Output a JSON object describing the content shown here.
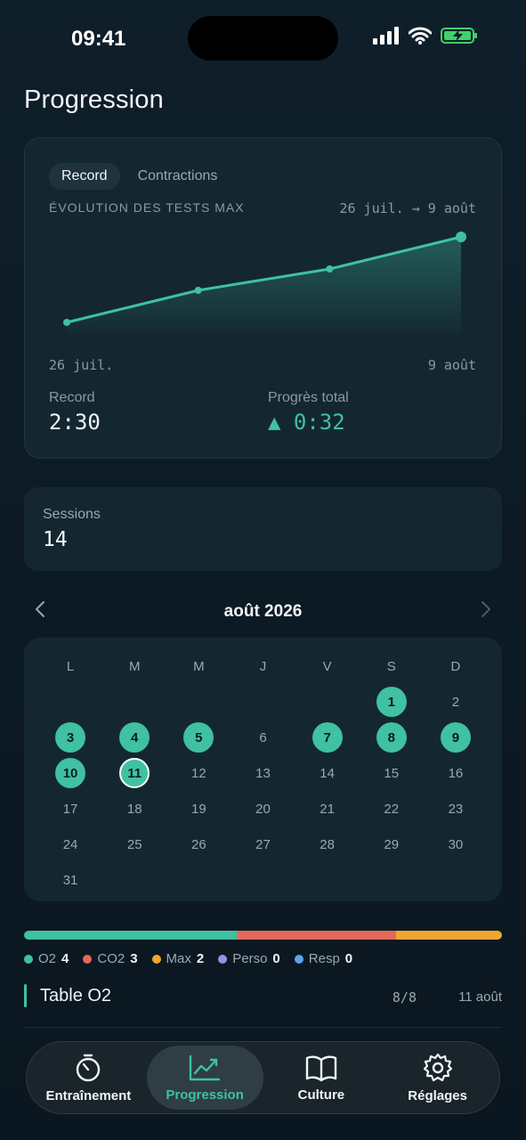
{
  "status_bar": {
    "time": "09:41"
  },
  "page": {
    "title": "Progression"
  },
  "chart_card": {
    "tabs": [
      {
        "label": "Record",
        "active": true
      },
      {
        "label": "Contractions",
        "active": false
      }
    ],
    "section_label": "ÉVOLUTION DES TESTS MAX",
    "date_range": "26 juil. → 9 août",
    "axis_start": "26 juil.",
    "axis_end": "9 août",
    "record_label": "Record",
    "record_value": "2:30",
    "progress_label": "Progrès total",
    "progress_value": "▲ 0:32"
  },
  "chart_data": {
    "type": "area",
    "x": [
      "26 juil.",
      "",
      "",
      "9 août"
    ],
    "series": [
      {
        "values": [
          118,
          130,
          138,
          150
        ]
      }
    ],
    "ylim": [
      112,
      152
    ],
    "grid": false,
    "color": "#3fc1a2"
  },
  "sessions": {
    "label": "Sessions",
    "value": "14"
  },
  "calendar": {
    "month": "août 2026",
    "prev_icon": "chevron-left-icon",
    "next_icon": "chevron-right-icon",
    "weekdays": [
      "L",
      "M",
      "M",
      "J",
      "V",
      "S",
      "D"
    ],
    "first_weekday_offset": 5,
    "days_in_month": 31,
    "completed_days": [
      1,
      3,
      4,
      5,
      7,
      8,
      9,
      10,
      11
    ],
    "today": 11
  },
  "distribution": {
    "segments": [
      {
        "name": "O2",
        "count": "4",
        "color": "#3fc1a2"
      },
      {
        "name": "CO2",
        "count": "3",
        "color": "#e26a5a"
      },
      {
        "name": "Max",
        "count": "2",
        "color": "#f0a631"
      },
      {
        "name": "Perso",
        "count": "0",
        "color": "#9b8fe0"
      },
      {
        "name": "Resp",
        "count": "0",
        "color": "#5aa6e8"
      }
    ]
  },
  "session_list": [
    {
      "title": "Table O2",
      "score": "8/8",
      "date": "11 août",
      "color": "#3fc1a2"
    }
  ],
  "tabbar": {
    "tabs": [
      {
        "label": "Entraînement",
        "icon": "stopwatch-icon",
        "active": false
      },
      {
        "label": "Progression",
        "icon": "chart-icon",
        "active": true
      },
      {
        "label": "Culture",
        "icon": "book-icon",
        "active": false
      },
      {
        "label": "Réglages",
        "icon": "gear-icon",
        "active": false
      }
    ]
  }
}
